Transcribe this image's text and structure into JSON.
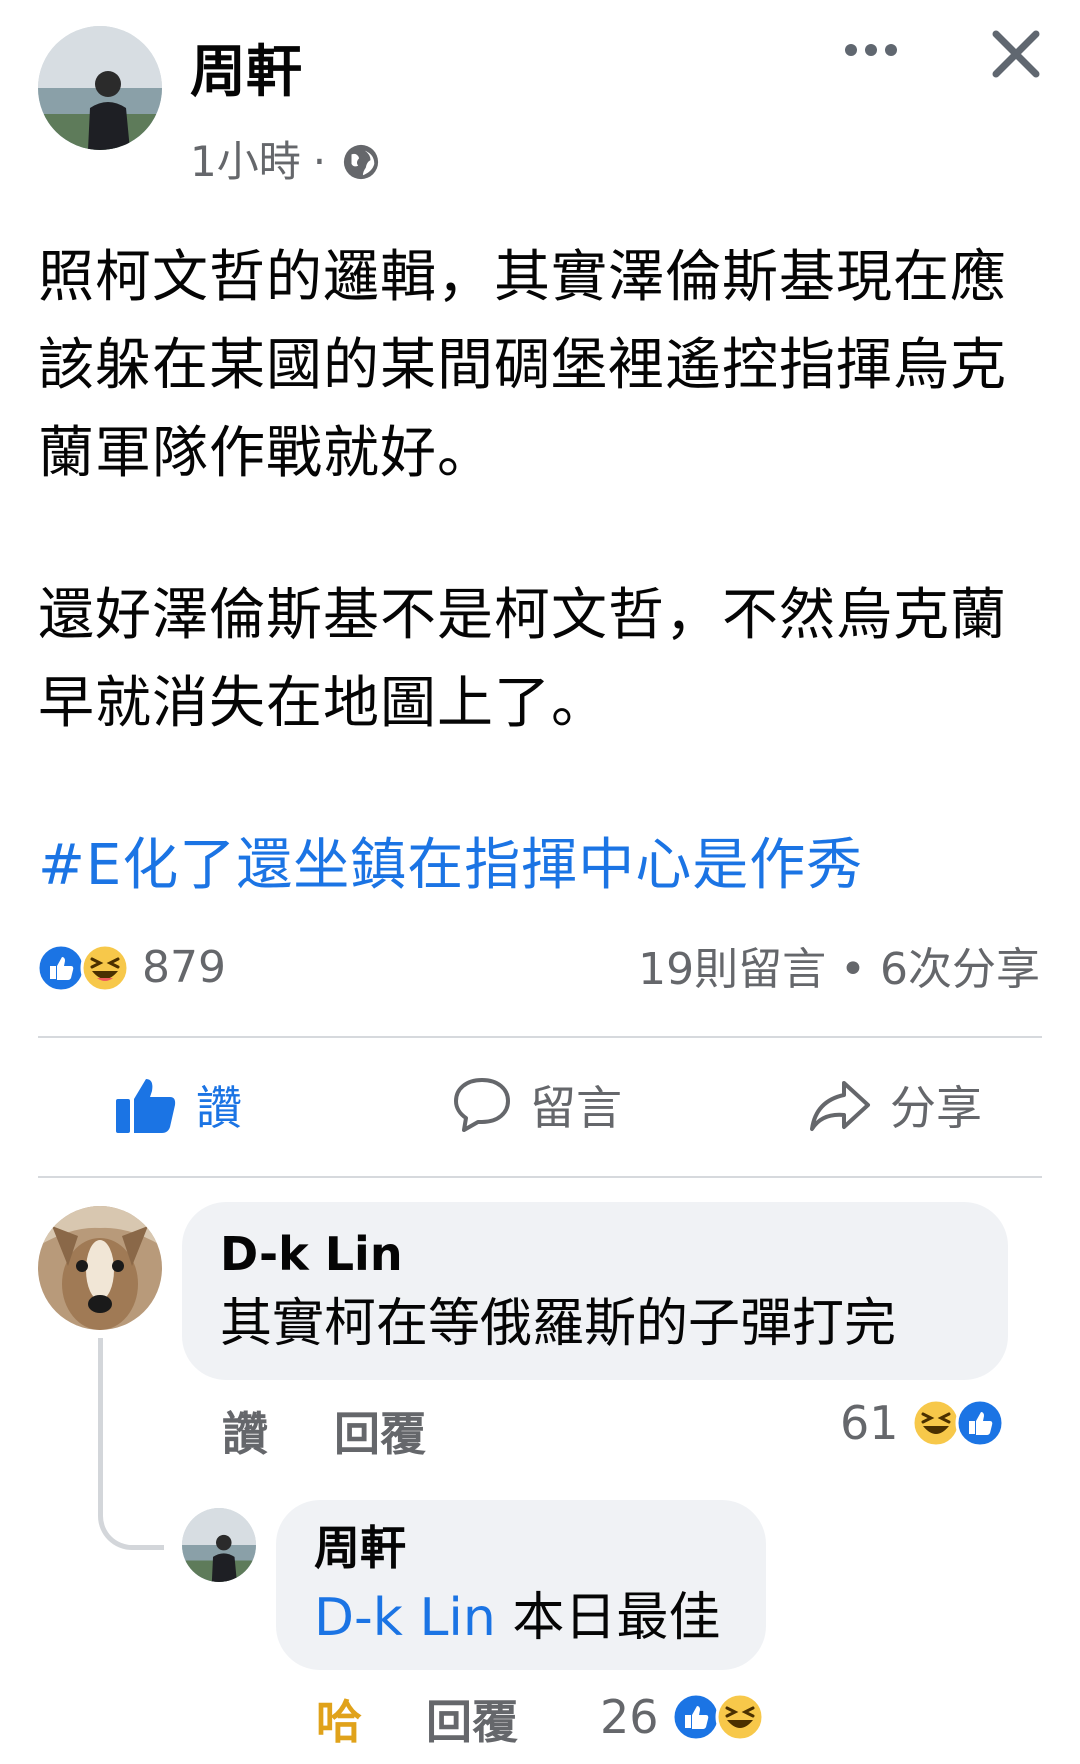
{
  "post": {
    "author": "周軒",
    "time": "1小時",
    "separator": "·",
    "paragraph1": "照柯文哲的邏輯，其實澤倫斯基現在應該躲在某國的某間碉堡裡遙控指揮烏克蘭軍隊作戰就好。",
    "paragraph2": "還好澤倫斯基不是柯文哲，不然烏克蘭早就消失在地圖上了。",
    "hashtag": "#E化了還坐鎮在指揮中心是作秀",
    "reaction_count": "879",
    "stats": "19則留言 • 6次分享"
  },
  "actions": {
    "like": "讚",
    "comment": "留言",
    "share": "分享"
  },
  "comments": [
    {
      "name": "D-k Lin",
      "text": "其實柯在等俄羅斯的子彈打完",
      "like_label": "讚",
      "reply_label": "回覆",
      "reaction_count": "61"
    },
    {
      "name": "周軒",
      "mention": "D-k Lin",
      "text": "本日最佳",
      "reaction_label": "哈",
      "reply_label": "回覆",
      "reaction_count": "26"
    }
  ],
  "colors": {
    "accent": "#1b74e4",
    "haha": "#e0a21a",
    "muted": "#65676b",
    "bubble": "#f0f2f5"
  },
  "icons": [
    "more-icon",
    "close-icon",
    "globe-icon",
    "like-icon",
    "comment-icon",
    "share-icon",
    "like-reaction-icon",
    "haha-reaction-icon"
  ]
}
